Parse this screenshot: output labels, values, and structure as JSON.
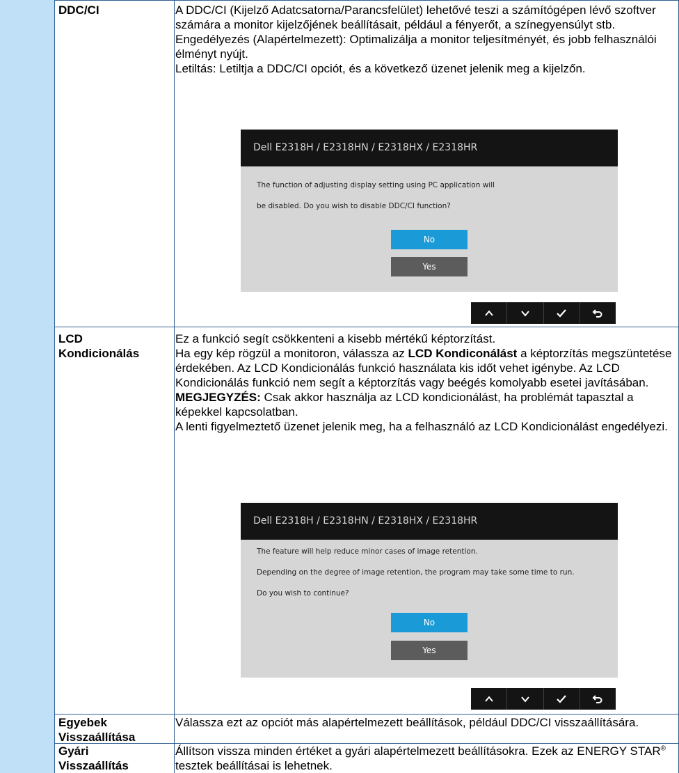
{
  "rows": [
    {
      "label_lines": [
        "DDC/CI"
      ],
      "paragraphs": [
        "A DDC/CI (Kijelző Adatcsatorna/Parancsfelület) lehetővé teszi a számítógépen lévő szoftver számára a monitor kijelzőjének beállításait, például a fényerőt, a színegyensúlyt stb.",
        "Engedélyezés (Alapértelmezett): Optimalizálja a monitor teljesítményét, és jobb felhasználói élményt nyújt.",
        "Letiltás: Letiltja a DDC/CI opciót, és a következő üzenet jelenik meg a kijelzőn."
      ],
      "dialog": {
        "title": "Dell E2318H / E2318HN / E2318HX / E2318HR",
        "lines": [
          "The function of adjusting display setting using PC application will",
          "be disabled. Do you wish to disable DDC/CI function?"
        ],
        "no_label": "No",
        "yes_label": "Yes"
      }
    },
    {
      "label_lines": [
        "LCD",
        "Kondicionálás"
      ],
      "paragraphs": [
        "Ez a funkció segít csökkenteni a kisebb mértékű képtorzítást.",
        "Ha egy kép rögzül a monitoron, válassza az",
        "LCD Kondiconálást",
        "a képtorzítás megszüntetése érdekében. Az LCD Kondicionálás funkció használata kis időt vehet igénybe. Az LCD Kondicionálás funkció nem segít a képtorzítás vagy beégés komolyabb esetei javításában.",
        "MEGJEGYZÉS:",
        "Csak akkor használja az LCD kondicionálást, ha problémát tapasztal a képekkel kapcsolatban.",
        "A lenti figyelmeztető üzenet jelenik meg, ha a felhasználó az LCD Kondicionálást engedélyezi."
      ],
      "dialog": {
        "title": "Dell E2318H / E2318HN / E2318HX / E2318HR",
        "lines": [
          "The feature will help reduce minor cases of image retention.",
          "Depending on the degree of image retention, the program may take some time to run.",
          "Do you wish to continue?"
        ],
        "no_label": "No",
        "yes_label": "Yes"
      }
    },
    {
      "label_lines": [
        "Egyebek",
        "Visszaállítása"
      ],
      "paragraphs": [
        "Válassza ezt az opciót más alapértelmezett beállítások, például DDC/CI visszaállítására."
      ]
    },
    {
      "label_lines": [
        "Gyári",
        "Visszaállítás"
      ],
      "paragraphs": [
        "Állítson vissza minden értéket a gyári alapértelmezett beállításokra. Ezek az ENERGY STAR",
        "®",
        " tesztek beállításai is lehetnek."
      ]
    }
  ],
  "nav_icons": [
    "chevron-up-icon",
    "chevron-down-icon",
    "checkmark-icon",
    "back-icon"
  ],
  "colors": {
    "left_column": "#bfe0f6",
    "border": "#2f5f93",
    "dialog_title_bg": "#141414",
    "dialog_body_bg": "#d6d6d6",
    "no_button": "#1a9ad6",
    "yes_button": "#5c5c5c"
  }
}
